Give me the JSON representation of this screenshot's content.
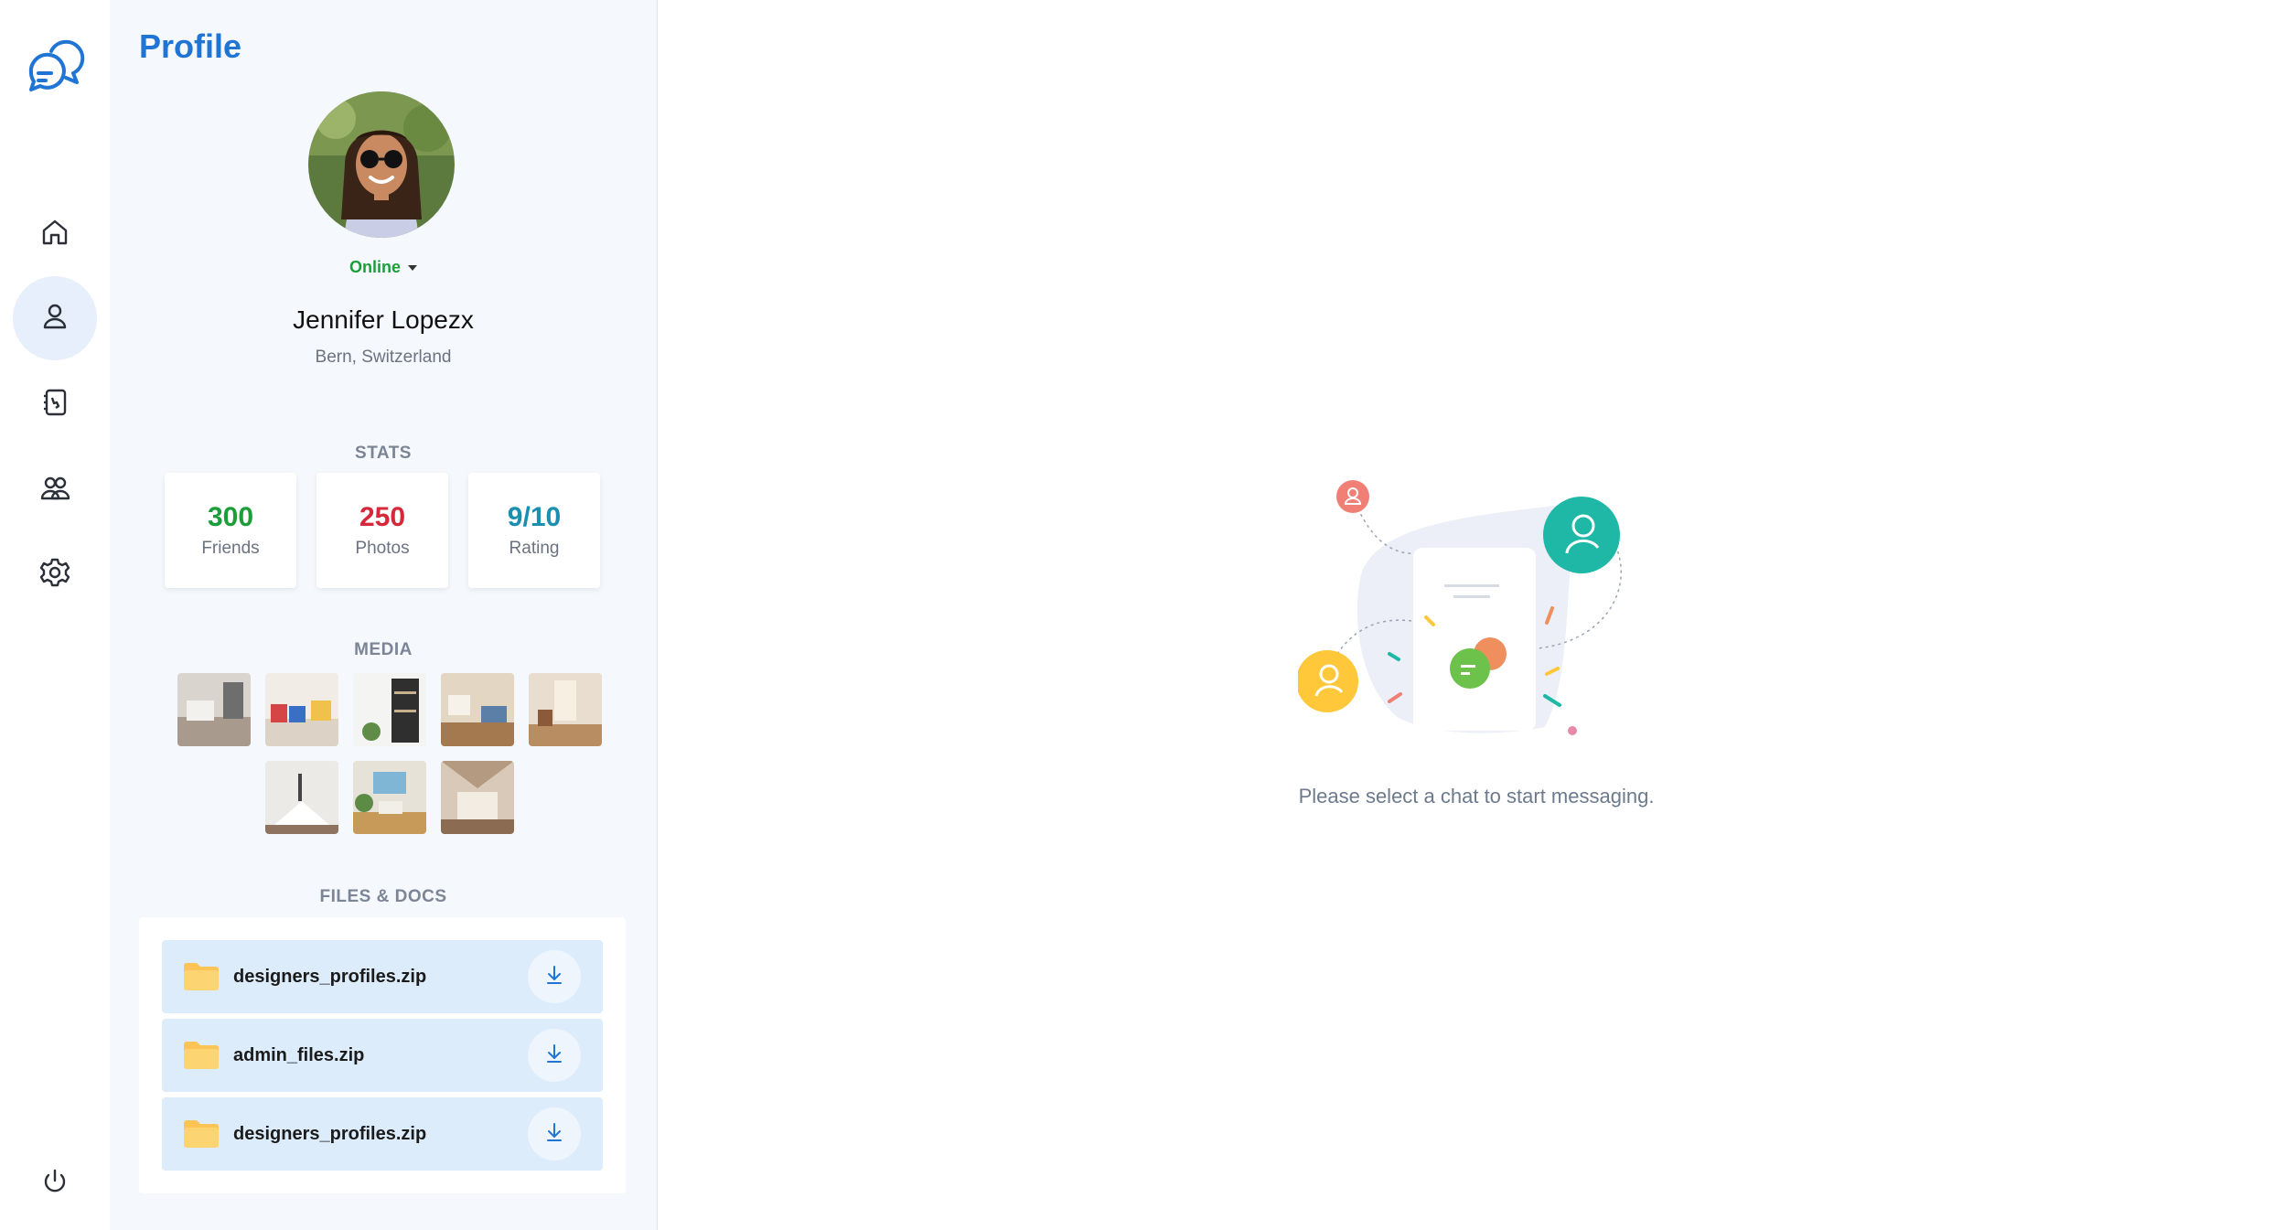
{
  "app": {
    "logo_icon": "chat-bubbles-logo",
    "accent_color": "#1f74d4"
  },
  "nav": {
    "items": [
      {
        "icon": "home-icon"
      },
      {
        "icon": "user-icon",
        "active": true
      },
      {
        "icon": "contacts-book-icon"
      },
      {
        "icon": "group-icon"
      },
      {
        "icon": "gear-icon"
      }
    ],
    "power_icon": "power-icon"
  },
  "profile": {
    "title": "Profile",
    "status": "Online",
    "name": "Jennifer Lopezx",
    "location": "Bern, Switzerland",
    "stats_label": "STATS",
    "stats": [
      {
        "value": "300",
        "label": "Friends",
        "color": "#1b9e3a"
      },
      {
        "value": "250",
        "label": "Photos",
        "color": "#d62839"
      },
      {
        "value": "9/10",
        "label": "Rating",
        "color": "#1a8fb0"
      }
    ],
    "media_label": "MEDIA",
    "media_count": 8,
    "files_label": "FILES & DOCS",
    "files": [
      {
        "name": "designers_profiles.zip"
      },
      {
        "name": "admin_files.zip"
      },
      {
        "name": "designers_profiles.zip"
      }
    ]
  },
  "main": {
    "empty_message": "Please select a chat to start messaging."
  }
}
